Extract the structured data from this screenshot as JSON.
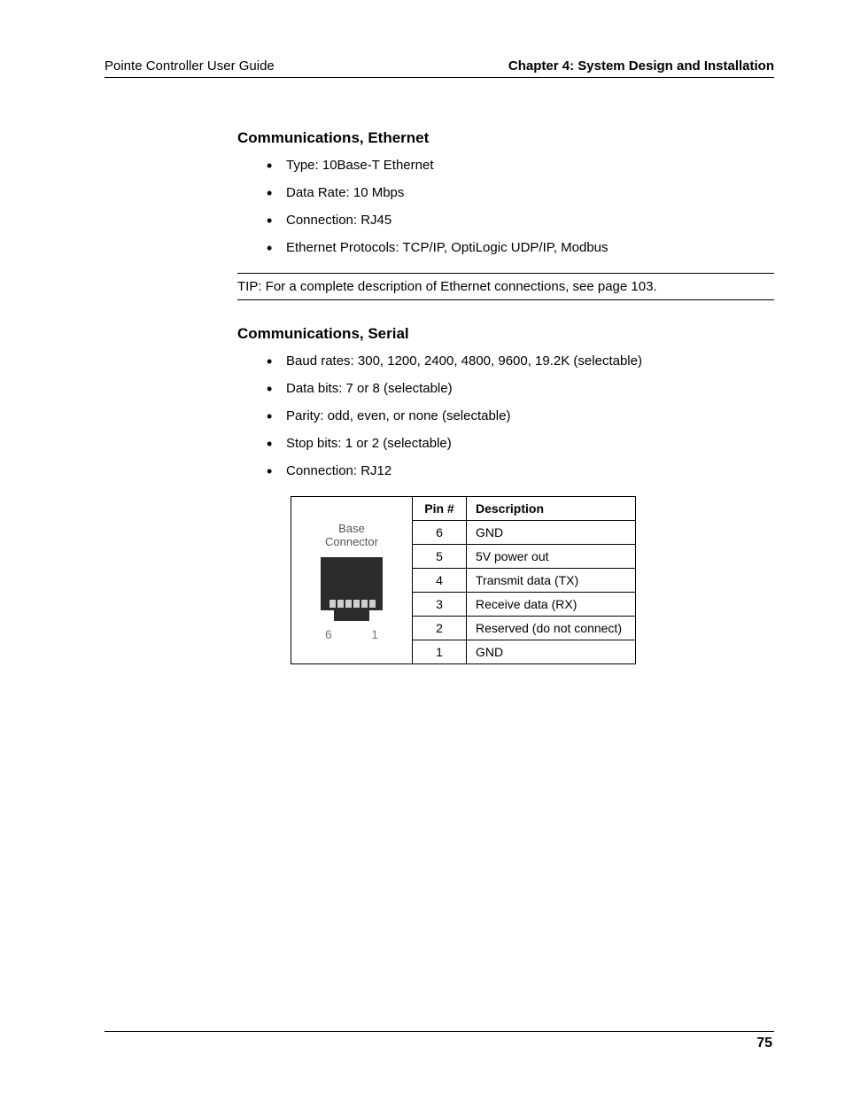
{
  "header": {
    "left": "Pointe Controller User Guide",
    "right": "Chapter 4: System Design and Installation"
  },
  "sections": {
    "ethernet": {
      "heading": "Communications, Ethernet",
      "bullets": [
        "Type: 10Base-T Ethernet",
        "Data Rate: 10 Mbps",
        "Connection: RJ45",
        "Ethernet Protocols: TCP/IP, OptiLogic UDP/IP, Modbus"
      ],
      "tip": "TIP: For a complete description of Ethernet connections, see page 103."
    },
    "serial": {
      "heading": "Communications, Serial",
      "bullets": [
        "Baud rates: 300, 1200, 2400, 4800, 9600, 19.2K (selectable)",
        "Data bits: 7 or 8 (selectable)",
        "Parity: odd, even, or none (selectable)",
        "Stop bits: 1 or 2 (selectable)",
        "Connection: RJ12"
      ]
    }
  },
  "connector": {
    "label1": "Base",
    "label2": "Connector",
    "left_num": "6",
    "right_num": "1"
  },
  "table": {
    "head_pin": "Pin #",
    "head_desc": "Description",
    "rows": [
      {
        "pin": "6",
        "desc": "GND"
      },
      {
        "pin": "5",
        "desc": "5V power out"
      },
      {
        "pin": "4",
        "desc": "Transmit data (TX)"
      },
      {
        "pin": "3",
        "desc": "Receive data (RX)"
      },
      {
        "pin": "2",
        "desc": "Reserved (do not connect)"
      },
      {
        "pin": "1",
        "desc": "GND"
      }
    ]
  },
  "page_number": "75"
}
